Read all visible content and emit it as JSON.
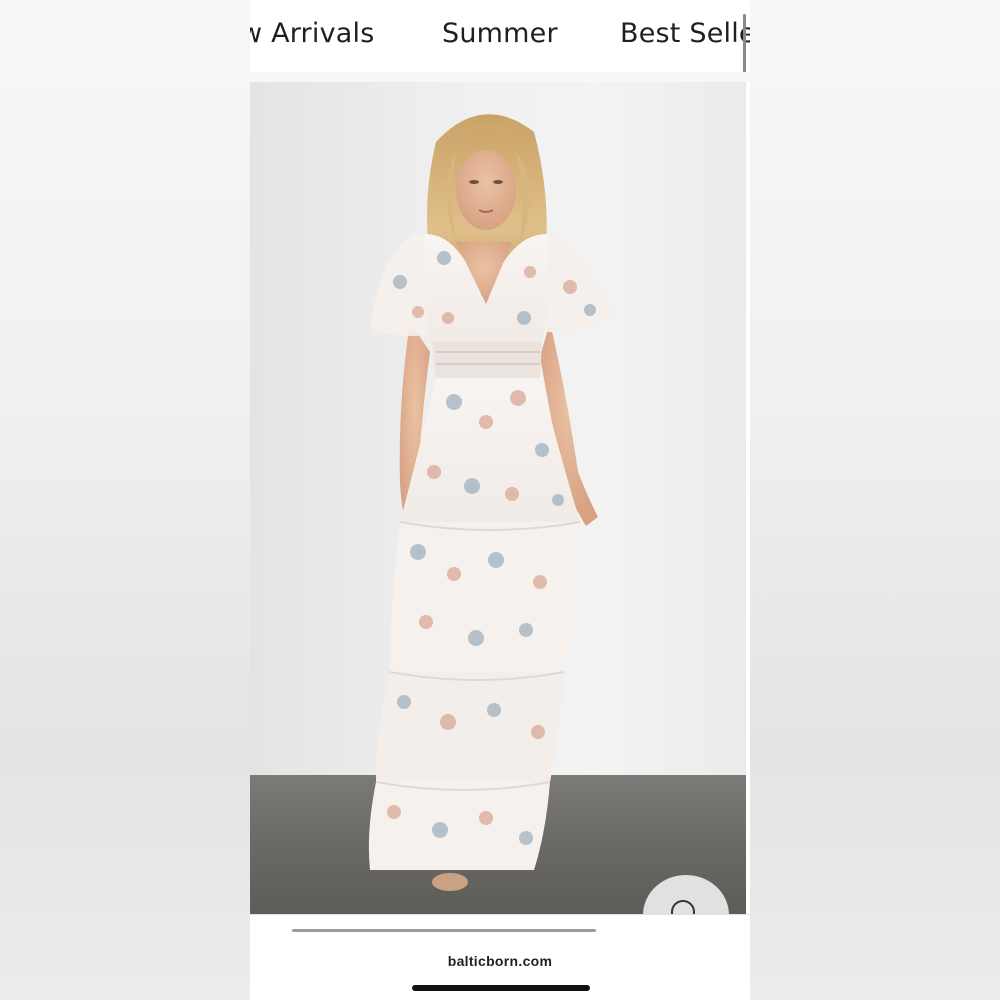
{
  "nav": {
    "items": [
      {
        "label": "w Arrivals"
      },
      {
        "label": "Summer"
      },
      {
        "label": "Best Selle"
      }
    ]
  },
  "product": {
    "image_alt": "Woman wearing a white tiered maxi dress with pink and blue floral print"
  },
  "zoom": {
    "icon": "search-icon"
  },
  "browser": {
    "url": "balticborn.com"
  },
  "colors": {
    "background": "#ffffff",
    "floor": "#6b6965",
    "text": "#1f1f1f"
  }
}
